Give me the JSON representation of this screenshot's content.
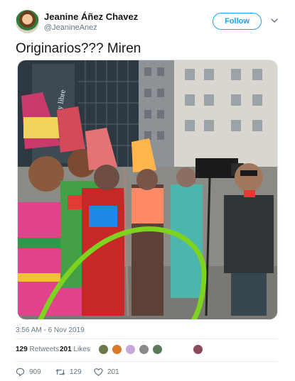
{
  "user": {
    "display_name": "Jeanine Áñez Chavez",
    "handle": "@JeanineAnez"
  },
  "follow_button": {
    "label": "Follow"
  },
  "tweet": {
    "text": "Originarios??? Miren",
    "timestamp": "3:56 AM - 6 Nov 2019"
  },
  "photo": {
    "sign_text": "y libre"
  },
  "stats": {
    "retweets_count": "129",
    "retweets_label": "Retweets",
    "likes_count": "201",
    "likes_label": "Likes"
  },
  "actions": {
    "reply_count": "909",
    "retweet_count": "129",
    "like_count": "201"
  },
  "colors": {
    "accent": "#1da1f2",
    "secondary_text": "#657786",
    "annotation_circle": "#7ed321"
  }
}
